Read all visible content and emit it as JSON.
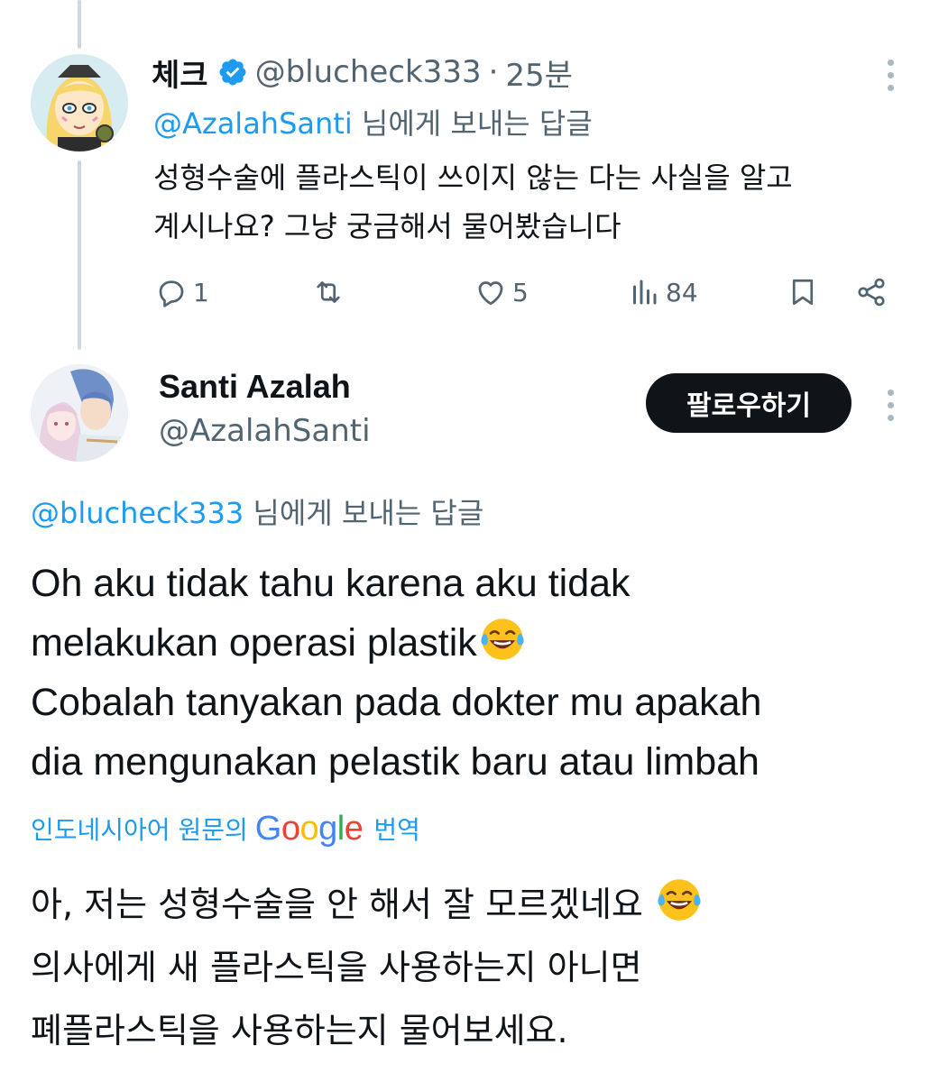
{
  "reply": {
    "display_name": "체크",
    "handle": "@blucheck333",
    "separator": "·",
    "time": "25분",
    "replying_to": {
      "mention": "@AzalahSanti",
      "suffix": " 님에게 보내는 답글"
    },
    "body_lines": [
      "성형수술에 플라스틱이 쓰이지 않는 다는 사실을 알고",
      "계시나요? 그냥 궁금해서 물어봤습니다"
    ],
    "actions": {
      "replies": "1",
      "reposts": "",
      "likes": "5",
      "views": "84"
    }
  },
  "post": {
    "display_name": "Santi Azalah",
    "handle": "@AzalahSanti",
    "follow_label": "팔로우하기",
    "replying_to": {
      "mention": "@blucheck333",
      "suffix": " 님에게 보내는 답글"
    },
    "body_lines": [
      "Oh aku tidak tahu karena aku tidak",
      "melakukan operasi plastik",
      "Cobalah tanyakan pada dokter mu apakah",
      "dia mengunakan pelastik baru atau limbah"
    ],
    "translation_bar": {
      "source": "인도네시아어 원문의",
      "provider": "Google",
      "action": "번역"
    },
    "translated_lines": [
      "아, 저는 성형수술을 안 해서 잘 모르겠네요",
      "의사에게 새 플라스틱을 사용하는지 아니면",
      "폐플라스틱을 사용하는지 물어보세요."
    ]
  },
  "colors": {
    "accent": "#1d9bf0",
    "text": "#0f1419",
    "muted": "#536471",
    "thread_line": "#cfd9de"
  }
}
